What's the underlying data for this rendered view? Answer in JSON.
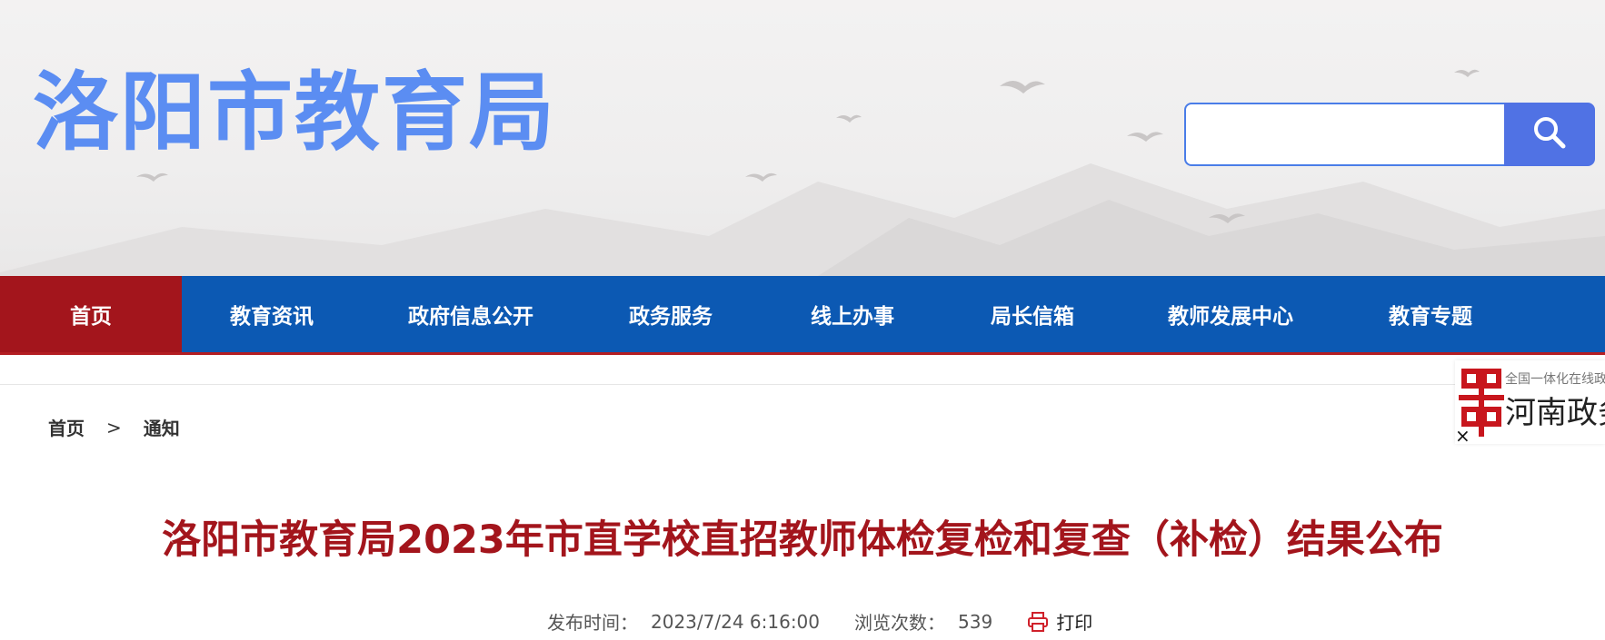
{
  "header": {
    "site_title": "洛阳市教育局",
    "search": {
      "value": ""
    }
  },
  "nav": {
    "items": [
      {
        "label": "首页"
      },
      {
        "label": "教育资讯"
      },
      {
        "label": "政府信息公开"
      },
      {
        "label": "政务服务"
      },
      {
        "label": "线上办事"
      },
      {
        "label": "局长信箱"
      },
      {
        "label": "教师发展中心"
      },
      {
        "label": "教育专题"
      }
    ],
    "active_index": 0
  },
  "breadcrumb": {
    "home": "首页",
    "separator": ">",
    "current": "通知"
  },
  "badge": {
    "subtitle": "全国一体化在线政",
    "title": "河南政务",
    "close": "×"
  },
  "article": {
    "title": "洛阳市教育局2023年市直学校直招教师体检复检和复查（补检）结果公布",
    "publish_label": "发布时间：",
    "publish_time": "2023/7/24 6:16:00",
    "views_label": "浏览次数：",
    "views": "539",
    "print_label": "打印"
  },
  "colors": {
    "title_blue": "#5b8df2",
    "nav_blue": "#0c59b3",
    "nav_active_red": "#a3151c",
    "article_title_red": "#a3151c",
    "search_button": "#5072e4"
  },
  "icons": [
    "search-icon",
    "printer-icon",
    "close-icon",
    "government-emblem-icon"
  ]
}
